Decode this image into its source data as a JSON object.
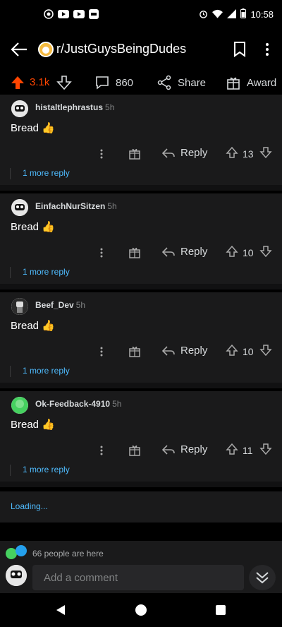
{
  "status_bar": {
    "time": "10:58"
  },
  "header": {
    "subreddit": "r/JustGuysBeingDudes"
  },
  "post_actions": {
    "votes": "3.1k",
    "comments": "860",
    "share": "Share",
    "award": "Award"
  },
  "comments": [
    {
      "user": "histaltlephrastus",
      "time": "5h",
      "body": "Bread 👍",
      "score": "13",
      "reply": "Reply",
      "more_replies": "1 more reply"
    },
    {
      "user": "EinfachNurSitzen",
      "time": "5h",
      "body": "Bread 👍",
      "score": "10",
      "reply": "Reply",
      "more_replies": "1 more reply"
    },
    {
      "user": "Beef_Dev",
      "time": "5h",
      "body": "Bread 👍",
      "score": "10",
      "reply": "Reply",
      "more_replies": "1 more reply"
    },
    {
      "user": "Ok-Feedback-4910",
      "time": "5h",
      "body": "Bread 👍",
      "score": "11",
      "reply": "Reply",
      "more_replies": "1 more reply"
    }
  ],
  "loading": "Loading...",
  "presence": "66 people are here",
  "composer": {
    "placeholder": "Add a comment"
  },
  "colors": {
    "upvote": "#ff4500",
    "link": "#4fbcff",
    "background": "#1a1a1b"
  }
}
